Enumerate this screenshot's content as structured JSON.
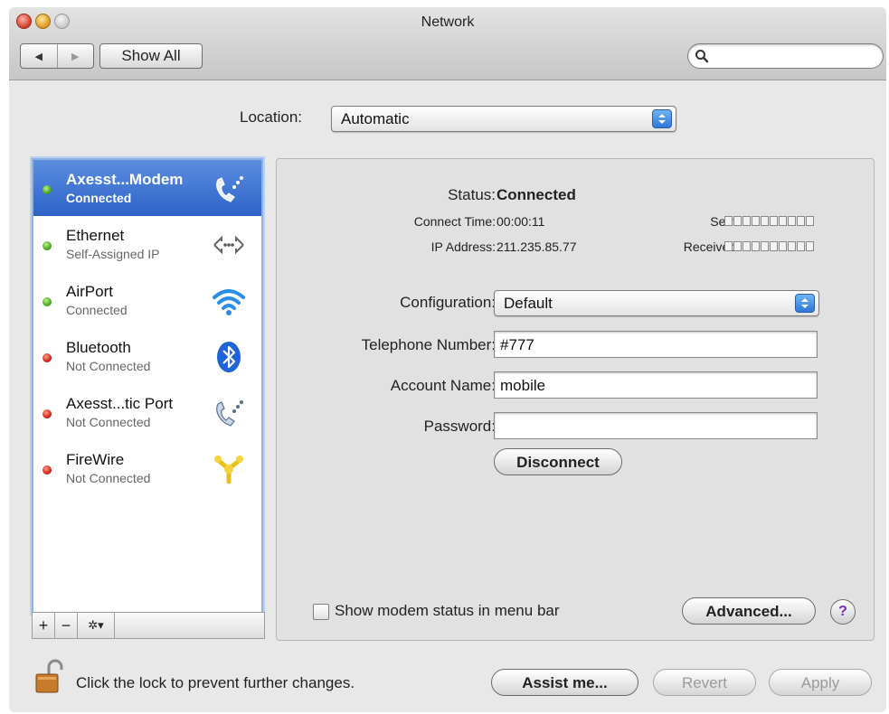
{
  "window": {
    "title": "Network"
  },
  "toolbar": {
    "back_label": "◀",
    "forward_label": "▶",
    "show_all_label": "Show All",
    "search_placeholder": ""
  },
  "location": {
    "label": "Location:",
    "value": "Automatic"
  },
  "services": [
    {
      "name": "Axesst...Modem",
      "status": "Connected",
      "indicator": "green",
      "icon": "phone-modem-icon",
      "selected": true
    },
    {
      "name": "Ethernet",
      "status": "Self-Assigned IP",
      "indicator": "green",
      "icon": "ethernet-arrows-icon",
      "selected": false
    },
    {
      "name": "AirPort",
      "status": "Connected",
      "indicator": "green",
      "icon": "wifi-icon",
      "selected": false
    },
    {
      "name": "Bluetooth",
      "status": "Not Connected",
      "indicator": "red",
      "icon": "bluetooth-icon",
      "selected": false
    },
    {
      "name": "Axesst...tic Port",
      "status": "Not Connected",
      "indicator": "red",
      "icon": "phone-modem-icon",
      "selected": false
    },
    {
      "name": "FireWire",
      "status": "Not Connected",
      "indicator": "red",
      "icon": "firewire-icon",
      "selected": false
    }
  ],
  "sidebar_buttons": {
    "add": "+",
    "remove": "−",
    "gear": "✲▾"
  },
  "detail": {
    "status_label": "Status:",
    "status_value": "Connected",
    "connect_time_label": "Connect Time:",
    "connect_time_value": "00:00:11",
    "ip_label": "IP Address:",
    "ip_value": "211.235.85.77",
    "sent_label": "Sent:",
    "received_label": "Received:",
    "configuration_label": "Configuration:",
    "configuration_value": "Default",
    "telephone_label": "Telephone Number:",
    "telephone_value": "#777",
    "account_label": "Account Name:",
    "account_value": "mobile",
    "password_label": "Password:",
    "password_value": "",
    "disconnect_label": "Disconnect",
    "show_modem_label": "Show modem status in menu bar",
    "show_modem_checked": false,
    "advanced_label": "Advanced...",
    "help_label": "?"
  },
  "footer": {
    "lock_text": "Click the lock to prevent further changes.",
    "assist_label": "Assist me...",
    "revert_label": "Revert",
    "apply_label": "Apply"
  },
  "colors": {
    "selection": "#2d62c6",
    "green": "#3a9a12",
    "red": "#c8140a",
    "accent": "#2f76d8"
  }
}
